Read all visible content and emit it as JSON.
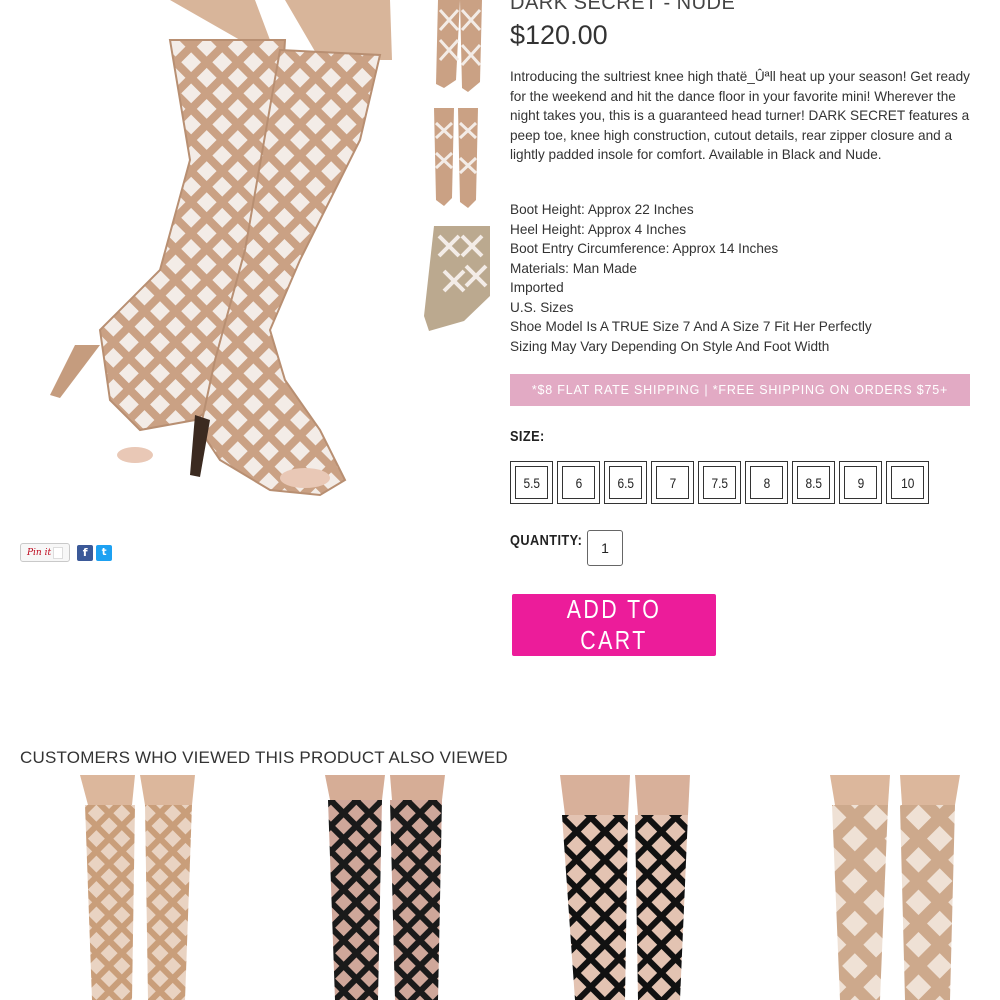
{
  "product": {
    "name": "DARK SECRET - NUDE",
    "price": "$120.00",
    "description": "Introducing the sultriest knee high thatë_Ûªll heat up your season! Get ready for the weekend and hit the dance floor in your favorite mini! Wherever the night takes you, this is a guaranteed head turner! DARK SECRET features a peep toe, knee high construction, cutout details, rear zipper closure and a lightly padded insole for comfort. Available in Black and Nude.",
    "specs": [
      "Boot Height: Approx 22 Inches",
      "Heel Height: Approx 4 Inches",
      "Boot Entry Circumference: Approx 14 Inches",
      "Materials: Man Made",
      "Imported",
      "U.S. Sizes",
      "Shoe Model Is A TRUE Size 7 And A Size 7 Fit Her Perfectly",
      "Sizing May Vary Depending On Style And Foot Width"
    ]
  },
  "shipping_banner": "*$8 FLAT RATE SHIPPING  |  *FREE SHIPPING ON ORDERS $75+",
  "size_label": "SIZE:",
  "sizes": [
    "5.5",
    "6",
    "6.5",
    "7",
    "7.5",
    "8",
    "8.5",
    "9",
    "10"
  ],
  "quantity_label": "QUANTITY:",
  "quantity_value": "1",
  "add_to_cart_label": "ADD TO CART",
  "share": {
    "pin_label": "Pin it",
    "facebook_glyph": "f",
    "twitter_glyph": "t"
  },
  "recommendations": {
    "heading": "CUSTOMERS WHO VIEWED THIS PRODUCT ALSO VIEWED",
    "items": [
      {
        "color": "nude-caged-boot"
      },
      {
        "color": "black-caged-boot"
      },
      {
        "color": "black-caged-boot"
      },
      {
        "color": "nude-strappy-boot"
      }
    ]
  },
  "colors": {
    "accent_pink": "#ec1c9a",
    "banner_pink": "#e2aac4",
    "nude": "#c9a284",
    "black": "#111111",
    "facebook": "#3b5998",
    "twitter": "#1da1f2"
  }
}
